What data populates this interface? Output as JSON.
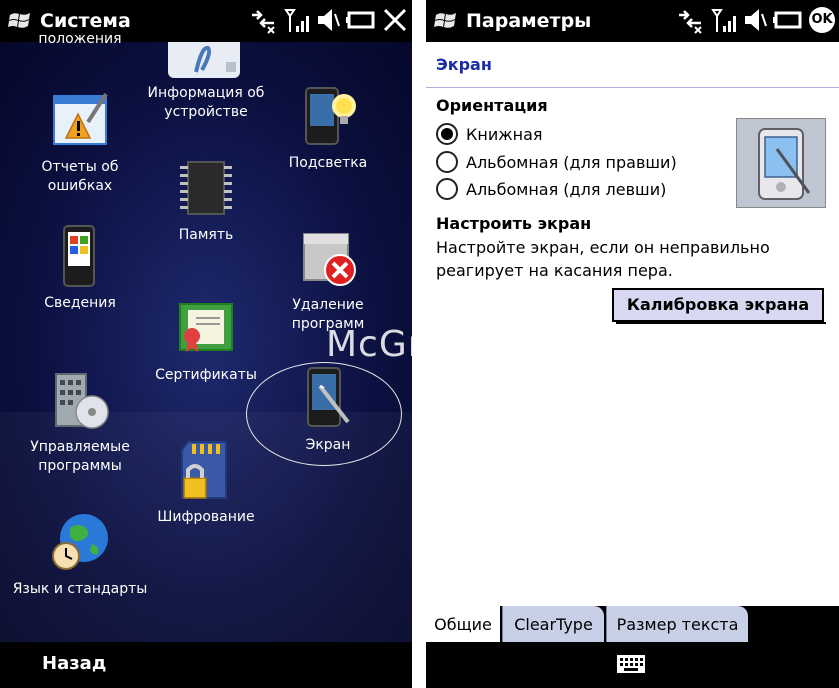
{
  "left": {
    "title": "Система",
    "partial_label": "положения",
    "apps": [
      {
        "label": "Информация об устройстве",
        "icon": "document-pen-icon"
      },
      {
        "label": "Отчеты об ошибках",
        "icon": "error-report-icon"
      },
      {
        "label": "Подсветка",
        "icon": "backlight-phone-icon"
      },
      {
        "label": "Память",
        "icon": "memory-chip-icon"
      },
      {
        "label": "Сведения",
        "icon": "windows-phone-icon"
      },
      {
        "label": "Удаление программ",
        "icon": "remove-programs-icon"
      },
      {
        "label": "Сертификаты",
        "icon": "certificate-icon"
      },
      {
        "label": "Экран",
        "icon": "screen-stylus-icon"
      },
      {
        "label": "Управляемые программы",
        "icon": "managed-programs-icon"
      },
      {
        "label": "Шифрование",
        "icon": "sd-lock-icon"
      },
      {
        "label": "Язык и стандарты",
        "icon": "globe-clock-icon"
      }
    ],
    "softkey_back": "Назад"
  },
  "right": {
    "title": "Параметры",
    "ok_label": "OK",
    "section": "Экран",
    "orientation_heading": "Ориентация",
    "orientation_options": [
      "Книжная",
      "Альбомная (для правши)",
      "Альбомная (для левши)"
    ],
    "orientation_selected": 0,
    "calibrate_heading": "Настроить экран",
    "calibrate_text_line1": "Настройте экран, если он неправильно",
    "calibrate_text_line2": "реагирует на касания пера.",
    "calibrate_button": "Калибровка экрана",
    "tabs": [
      "Общие",
      "ClearType",
      "Размер текста"
    ],
    "active_tab": 0
  },
  "watermark": "McGrp.Ru",
  "colors": {
    "accent_blue": "#1a2ea8",
    "left_background": "#0a0f3c",
    "button_fill": "#d8d8f2"
  }
}
